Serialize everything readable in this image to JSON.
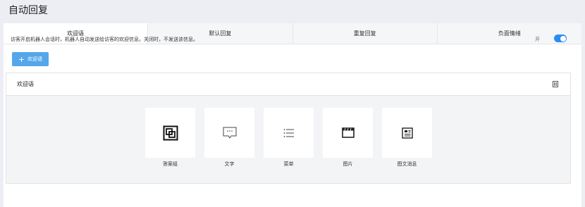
{
  "page": {
    "title": "自动回复"
  },
  "tabs": [
    {
      "label": "欢迎语",
      "active": true
    },
    {
      "label": "默认回复",
      "active": false
    },
    {
      "label": "重复回复",
      "active": false
    },
    {
      "label": "负面情绪",
      "active": false
    }
  ],
  "welcome": {
    "description": "访客开启机器人会话时，机器人自动发送给访客的欢迎信息。关闭时，不发送该信息。",
    "toggle_label": "开",
    "toggle_on": true,
    "add_button_label": "欢迎语",
    "card_title": "欢迎语"
  },
  "reply_types": [
    {
      "label": "答案组",
      "icon": "answer-group-icon"
    },
    {
      "label": "文字",
      "icon": "text-icon"
    },
    {
      "label": "菜单",
      "icon": "menu-icon"
    },
    {
      "label": "图片",
      "icon": "image-icon"
    },
    {
      "label": "图文消息",
      "icon": "image-text-icon"
    }
  ],
  "colors": {
    "accent": "#2d8cf0",
    "button": "#55a6ea"
  }
}
